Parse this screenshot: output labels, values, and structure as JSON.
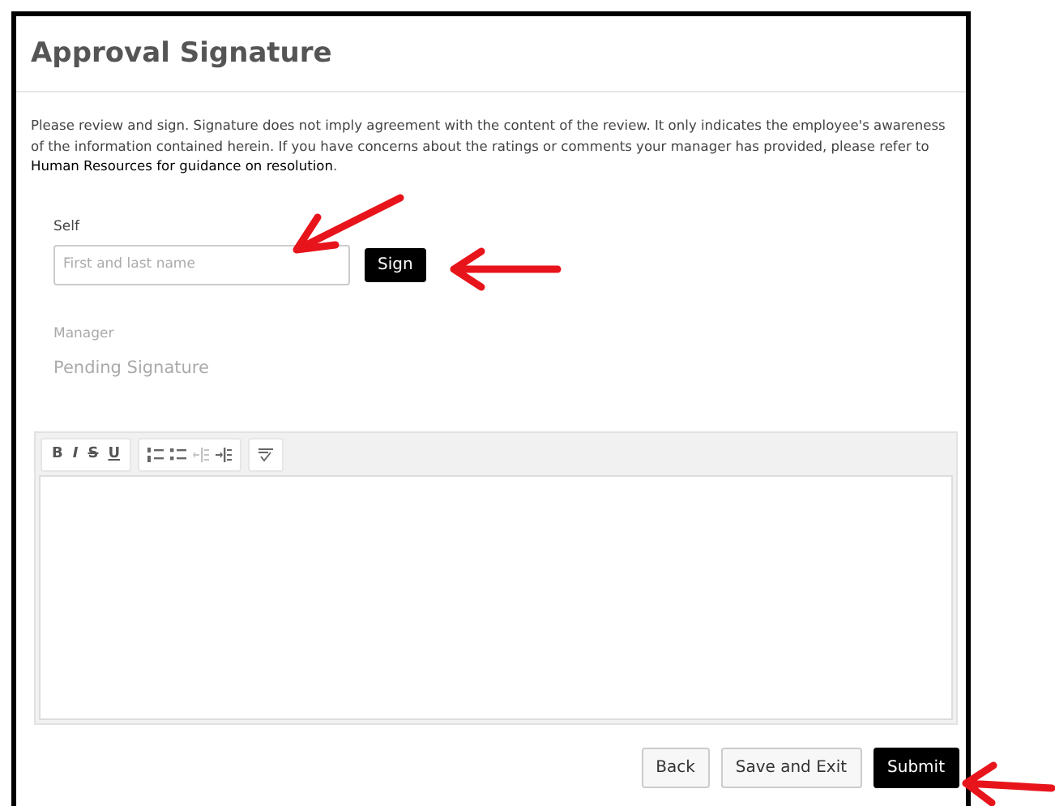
{
  "title": "Approval Signature",
  "intro": {
    "text": "Please review and sign. Signature does not imply agreement with the content of the review. It only indicates the employee's awareness of the information contained herein. If you have concerns about the ratings or comments your manager has provided, please refer to ",
    "link": "Human Resources for guidance on resolution",
    "end": "."
  },
  "self": {
    "label": "Self",
    "placeholder": "First and last name",
    "button": "Sign"
  },
  "manager": {
    "label": "Manager",
    "status": "Pending Signature"
  },
  "toolbar": [
    [
      {
        "kind": "bold",
        "label": "B",
        "disabled": false
      },
      {
        "kind": "italic",
        "label": "I",
        "disabled": false
      },
      {
        "kind": "strike",
        "label": "S",
        "disabled": false
      },
      {
        "kind": "underline",
        "label": "U",
        "disabled": false
      }
    ],
    [
      {
        "kind": "ordered-list",
        "disabled": false
      },
      {
        "kind": "bullet-list",
        "disabled": false
      },
      {
        "kind": "outdent",
        "disabled": true
      },
      {
        "kind": "indent",
        "disabled": false
      }
    ],
    [
      {
        "kind": "spellcheck",
        "disabled": false
      }
    ]
  ],
  "buttons": [
    {
      "label": "Back",
      "kind": "secondary"
    },
    {
      "label": "Save and Exit",
      "kind": "secondary"
    },
    {
      "label": "Submit",
      "kind": "primary"
    }
  ]
}
